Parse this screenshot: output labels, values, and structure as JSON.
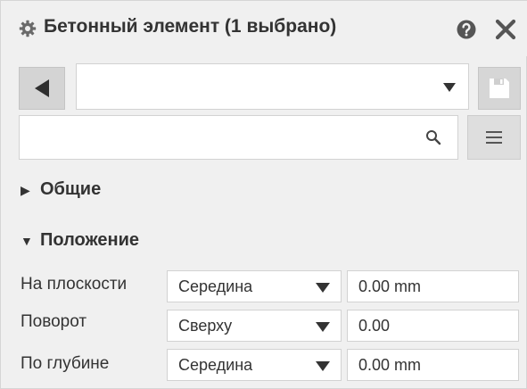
{
  "window": {
    "title": "Бетонный элемент (1 выбрано)",
    "icons": {
      "settings": "gear-icon",
      "help": "question-icon",
      "close": "close-icon"
    }
  },
  "toolbar": {
    "back_icon": "triangle-left-icon",
    "dropdown_value": "",
    "save_icon": "save-icon"
  },
  "search": {
    "value": "",
    "placeholder": "",
    "icon": "search-icon",
    "menu_icon": "menu-icon"
  },
  "sections": {
    "general": {
      "label": "Общие",
      "expanded": false
    },
    "position": {
      "label": "Положение",
      "expanded": true
    }
  },
  "properties": [
    {
      "label": "На плоскости",
      "option": "Середина",
      "value": "0.00 mm"
    },
    {
      "label": "Поворот",
      "option": "Сверху",
      "value": "0.00"
    },
    {
      "label": "По глубине",
      "option": "Середина",
      "value": "0.00 mm"
    }
  ],
  "colors": {
    "panel_bg": "#f0f0f0",
    "button_bg": "#d4d4d4",
    "text": "#333333",
    "icon": "#555555"
  }
}
